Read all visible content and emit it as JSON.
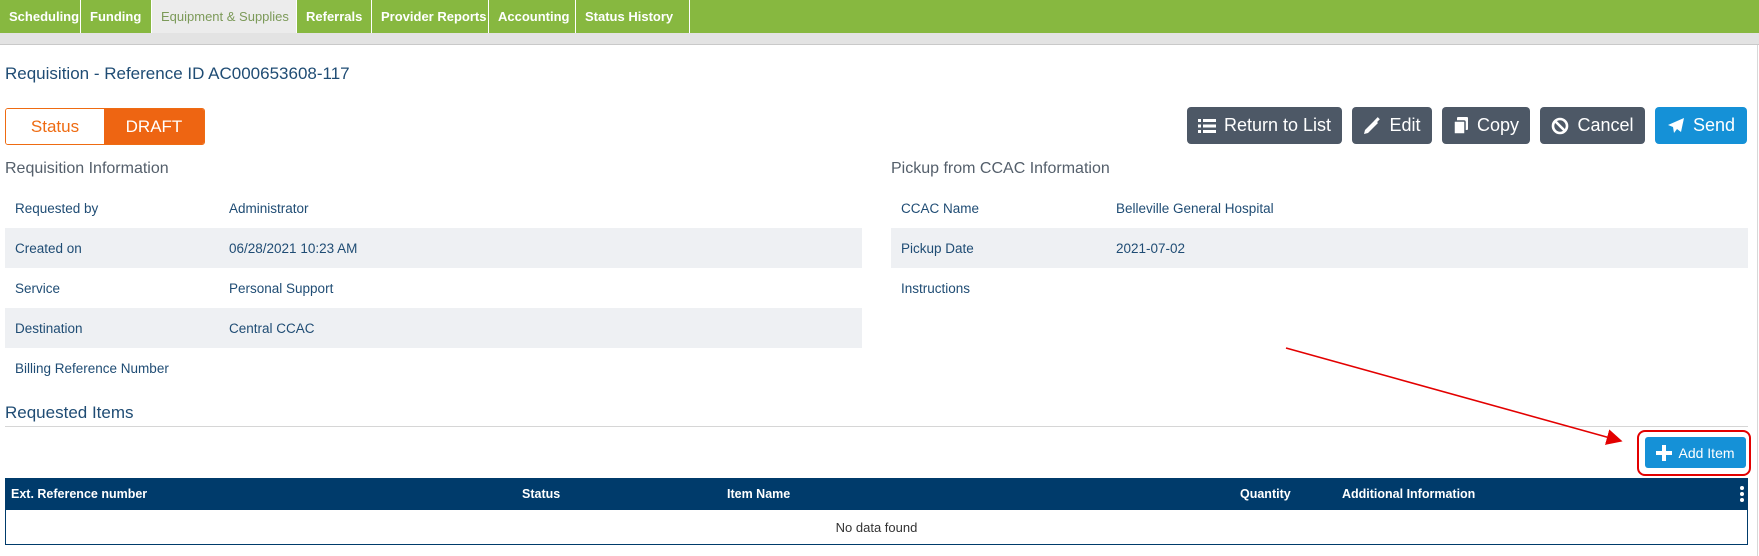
{
  "tabs": [
    {
      "label": "Scheduling"
    },
    {
      "label": "Funding"
    },
    {
      "label": "Equipment & Supplies"
    },
    {
      "label": "Referrals"
    },
    {
      "label": "Provider Reports"
    },
    {
      "label": "Accounting"
    },
    {
      "label": "Status History"
    }
  ],
  "active_tab": "Equipment & Supplies",
  "page_title": "Requisition - Reference ID AC000653608-117",
  "status": {
    "label": "Status",
    "value": "DRAFT"
  },
  "actions": {
    "return_to_list": "Return to List",
    "edit": "Edit",
    "copy": "Copy",
    "cancel": "Cancel",
    "send": "Send"
  },
  "requisition_info": {
    "title": "Requisition Information",
    "rows": [
      {
        "label": "Requested by",
        "value": "Administrator"
      },
      {
        "label": "Created on",
        "value": "06/28/2021 10:23 AM"
      },
      {
        "label": "Service",
        "value": "Personal Support"
      },
      {
        "label": "Destination",
        "value": "Central CCAC"
      },
      {
        "label": "Billing Reference Number",
        "value": ""
      }
    ]
  },
  "pickup_info": {
    "title": "Pickup from CCAC Information",
    "rows": [
      {
        "label": "CCAC Name",
        "value": "Belleville General Hospital"
      },
      {
        "label": "Pickup Date",
        "value": "2021-07-02"
      },
      {
        "label": "Instructions",
        "value": ""
      }
    ]
  },
  "requested_items": {
    "title": "Requested Items",
    "add_label": "Add Item",
    "columns": [
      "Ext. Reference number",
      "Status",
      "Item Name",
      "Quantity",
      "Additional Information"
    ],
    "empty_text": "No data found"
  },
  "colors": {
    "tabbar": "#87b840",
    "status_orange": "#ee6512",
    "button_dark": "#4d5866",
    "button_blue": "#1591d7",
    "table_header": "#003b6b",
    "highlight_red": "#e30000"
  },
  "icons": [
    "list-icon",
    "pencil-icon",
    "copy-icon",
    "ban-icon",
    "paper-plane-icon",
    "plus-icon",
    "kebab-icon"
  ]
}
